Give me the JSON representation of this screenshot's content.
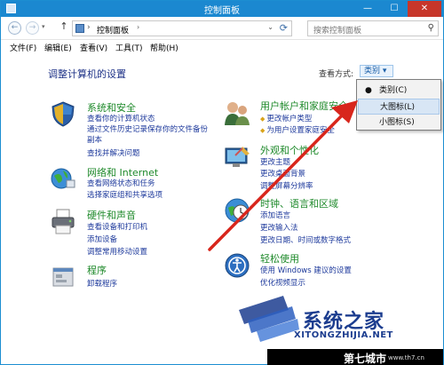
{
  "window": {
    "title": "控制面板",
    "minimize": "—",
    "maximize": "☐",
    "close": "✕"
  },
  "nav": {
    "back": "←",
    "forward": "→",
    "up": "↑",
    "separator": "›",
    "breadcrumb": "控制面板",
    "breadcrumb_arrow": "›",
    "dropdown": "⌄",
    "refresh": "⟳",
    "search_placeholder": "搜索控制面板",
    "search_icon": "⚲"
  },
  "menubar": [
    {
      "label": "文件(F)"
    },
    {
      "label": "编辑(E)"
    },
    {
      "label": "查看(V)"
    },
    {
      "label": "工具(T)"
    },
    {
      "label": "帮助(H)"
    }
  ],
  "content": {
    "heading": "调整计算机的设置",
    "view_by_label": "查看方式:",
    "view_by_value": "类别 ▾"
  },
  "categories": [
    {
      "title": "系统和安全",
      "icon": "shield-icon",
      "links": [
        "查看你的计算机状态",
        "通过文件历史记录保存你的文件备份",
        "副本",
        "查找并解决问题"
      ]
    },
    {
      "title": "网络和 Internet",
      "icon": "network-icon",
      "links": [
        "查看网络状态和任务",
        "选择家庭组和共享选项"
      ]
    },
    {
      "title": "硬件和声音",
      "icon": "printer-icon",
      "links": [
        "查看设备和打印机",
        "添加设备",
        "调整常用移动设置"
      ]
    },
    {
      "title": "程序",
      "icon": "programs-icon",
      "links": [
        "卸载程序"
      ]
    },
    {
      "title": "用户帐户和家庭安全",
      "icon": "users-icon",
      "links": [
        "更改帐户类型",
        "为用户设置家庭安全"
      ]
    },
    {
      "title": "外观和个性化",
      "icon": "appearance-icon",
      "links": [
        "更改主题",
        "更改桌面背景",
        "调整屏幕分辨率"
      ]
    },
    {
      "title": "时钟、语言和区域",
      "icon": "clock-globe-icon",
      "links": [
        "添加语言",
        "更改输入法",
        "更改日期、时间或数字格式"
      ]
    },
    {
      "title": "轻松使用",
      "icon": "ease-of-access-icon",
      "links": [
        "使用 Windows 建议的设置",
        "优化视频显示"
      ]
    }
  ],
  "view_menu": {
    "items": [
      {
        "label": "类别(C)",
        "bullet": "●"
      },
      {
        "label": "大图标(L)",
        "bullet": ""
      },
      {
        "label": "小图标(S)",
        "bullet": ""
      }
    ]
  },
  "watermark": {
    "brand": "系统之家",
    "pinyin": "XITONGZHIJIA.NET",
    "bottom_brand": "第七城市",
    "bottom_url": "www.th7.cn"
  },
  "colors": {
    "titlebar": "#1b88d0",
    "category_title": "#1f8a2b",
    "link": "#1e3a9c",
    "heading": "#1e3287",
    "annotation_arrow": "#d8261c"
  }
}
